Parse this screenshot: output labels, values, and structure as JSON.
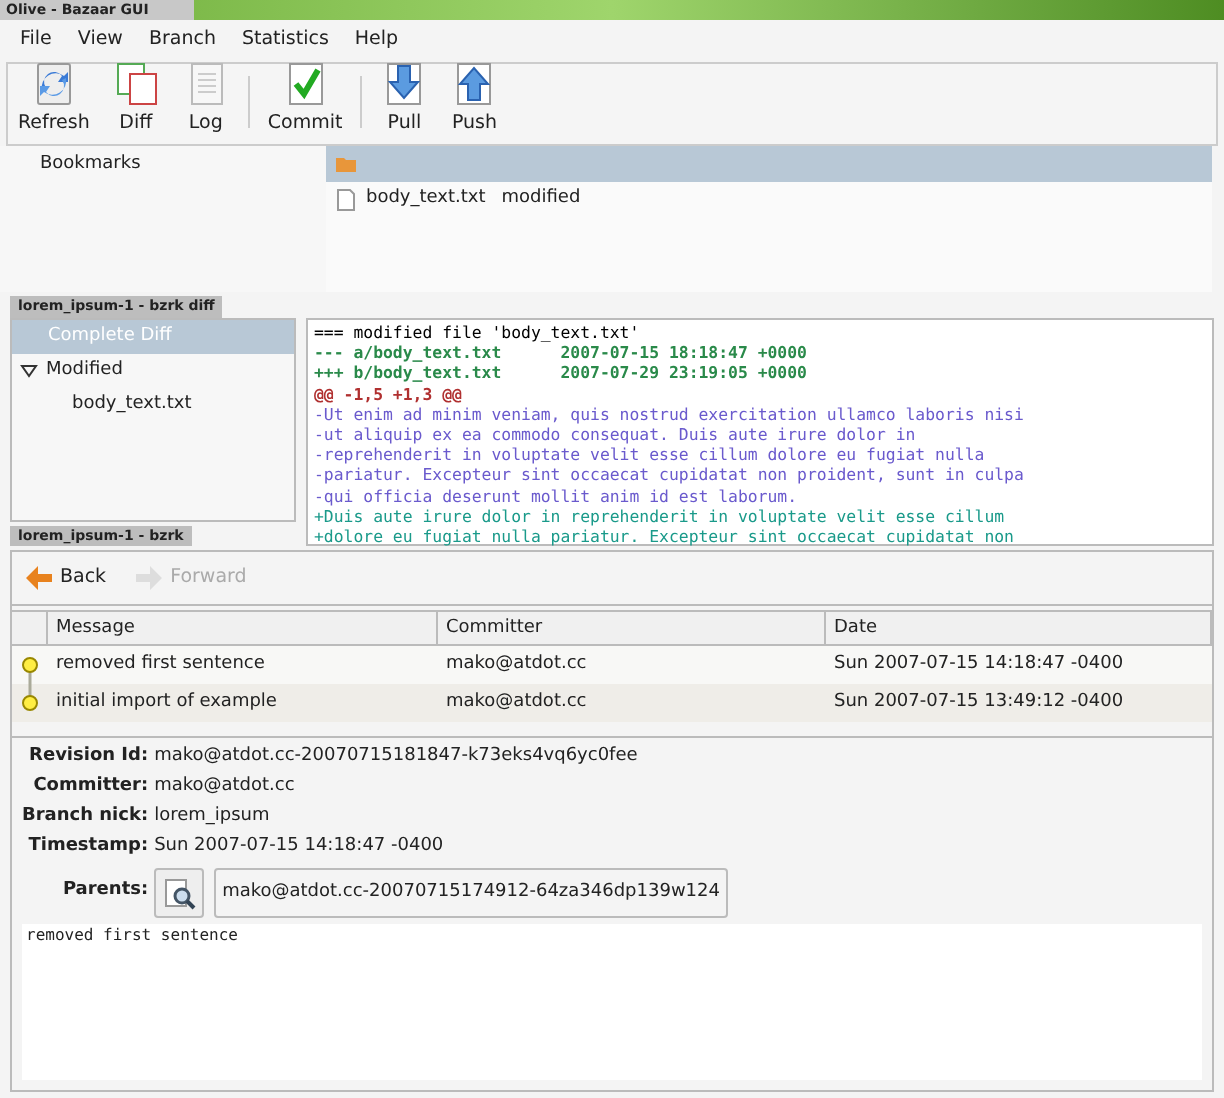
{
  "window": {
    "title": "Olive - Bazaar GUI"
  },
  "menu": [
    "File",
    "View",
    "Branch",
    "Statistics",
    "Help"
  ],
  "toolbar": [
    {
      "label": "Refresh",
      "kind": "refresh"
    },
    {
      "label": "Diff",
      "kind": "diff"
    },
    {
      "label": "Log",
      "kind": "log"
    },
    {
      "label": "Commit",
      "kind": "commit",
      "separator_before": true
    },
    {
      "label": "Pull",
      "kind": "pull",
      "separator_before": true
    },
    {
      "label": "Push",
      "kind": "push"
    }
  ],
  "bookmarks": {
    "title": "Bookmarks"
  },
  "files": [
    {
      "kind": "folder",
      "selected": true
    },
    {
      "kind": "file",
      "name": "body_text.txt",
      "status": "modified",
      "selected": false
    }
  ],
  "diff_window": {
    "title": "lorem_ipsum-1 - bzrk diff",
    "tree": [
      {
        "label": "Complete Diff",
        "selected": true
      },
      {
        "label": "Modified",
        "selected": false,
        "expanded": true,
        "children": [
          {
            "label": "body_text.txt",
            "selected": false
          }
        ]
      }
    ],
    "lines": [
      {
        "kind": "header",
        "text": "=== modified file 'body_text.txt'"
      },
      {
        "kind": "file",
        "text": "--- a/body_text.txt      2007-07-15 18:18:47 +0000"
      },
      {
        "kind": "file",
        "text": "+++ b/body_text.txt      2007-07-29 23:19:05 +0000"
      },
      {
        "kind": "hunk",
        "text": "@@ -1,5 +1,3 @@"
      },
      {
        "kind": "removed",
        "text": "-Ut enim ad minim veniam, quis nostrud exercitation ullamco laboris nisi"
      },
      {
        "kind": "removed",
        "text": "-ut aliquip ex ea commodo consequat. Duis aute irure dolor in"
      },
      {
        "kind": "removed",
        "text": "-reprehenderit in voluptate velit esse cillum dolore eu fugiat nulla"
      },
      {
        "kind": "removed",
        "text": "-pariatur. Excepteur sint occaecat cupidatat non proident, sunt in culpa"
      },
      {
        "kind": "removed",
        "text": "-qui officia deserunt mollit anim id est laborum."
      },
      {
        "kind": "added",
        "text": "+Duis aute irure dolor in reprehenderit in voluptate velit esse cillum"
      },
      {
        "kind": "added",
        "text": "+dolore eu fugiat nulla pariatur. Excepteur sint occaecat cupidatat non"
      }
    ]
  },
  "log_window": {
    "title": "lorem_ipsum-1 - bzrk",
    "nav": [
      {
        "label": "Back",
        "kind": "back",
        "disabled": false
      },
      {
        "label": "Forward",
        "kind": "forward",
        "disabled": true
      }
    ],
    "columns": [
      "Message",
      "Committer",
      "Date"
    ],
    "rows": [
      {
        "message": "removed first sentence",
        "committer": "mako@atdot.cc",
        "date": "Sun 2007-07-15 14:18:47 -0400"
      },
      {
        "message": "initial import of example",
        "committer": "mako@atdot.cc",
        "date": "Sun 2007-07-15 13:49:12 -0400"
      }
    ],
    "details": [
      {
        "label": "Revision Id:",
        "value": "mako@atdot.cc-20070715181847-k73eks4vq6yc0fee"
      },
      {
        "label": "Committer:",
        "value": "mako@atdot.cc"
      },
      {
        "label": "Branch nick:",
        "value": "lorem_ipsum"
      },
      {
        "label": "Timestamp:",
        "value": "Sun 2007-07-15 14:18:47 -0400"
      }
    ],
    "parents": {
      "label": "Parents:",
      "value": "mako@atdot.cc-20070715174912-64za346dp139w124"
    },
    "message": "removed first sentence"
  }
}
